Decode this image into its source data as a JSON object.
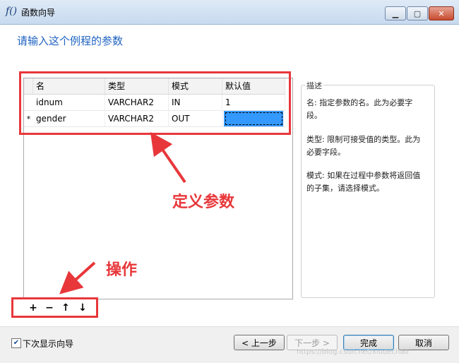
{
  "window": {
    "icon_glyph": "f()",
    "title": "函数向导",
    "controls": [
      "minimize",
      "maximize",
      "close"
    ]
  },
  "page": {
    "heading": "请输入这个例程的参数"
  },
  "params_grid": {
    "columns": [
      "名",
      "类型",
      "模式",
      "默认值"
    ],
    "rows": [
      {
        "marker": "",
        "name": "idnum",
        "type": "VARCHAR2",
        "mode": "IN",
        "default": "1"
      },
      {
        "marker": "*",
        "name": "gender",
        "type": "VARCHAR2",
        "mode": "OUT",
        "default": ""
      }
    ]
  },
  "description": {
    "title": "描述",
    "paragraphs": [
      "名: 指定参数的名。此为必要字段。",
      "类型: 限制可接受值的类型。此为必要字段。",
      "模式: 如果在过程中参数将返回值的子集，请选择模式。"
    ]
  },
  "toolbar": {
    "add": "+",
    "remove": "−",
    "move_up": "↑",
    "move_down": "↓"
  },
  "annotations": {
    "define_params": "定义参数",
    "operations": "操作",
    "color": "#e8373a"
  },
  "footer": {
    "show_wizard_label": "下次显示向导",
    "show_wizard_checked": true,
    "back_label": "< 上一步",
    "next_label": "下一步 >",
    "finish_label": "完成",
    "cancel_label": "取消"
  },
  "watermark": "https://blog.csdn.net/xiudechao"
}
